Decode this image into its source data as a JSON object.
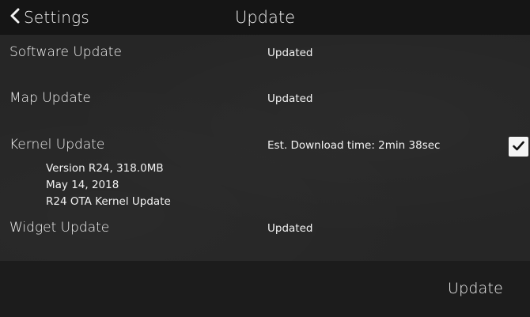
{
  "header": {
    "back_label": "Settings",
    "title": "Update"
  },
  "updates": [
    {
      "label": "Software Update",
      "status": "Updated"
    },
    {
      "label": "Map Update",
      "status": "Updated"
    },
    {
      "label": "Kernel Update",
      "status": "Est. Download time: 2min  38sec",
      "details": [
        "Version R24, 318.0MB",
        "May 14, 2018",
        "R24 OTA Kernel Update"
      ],
      "selected": true
    },
    {
      "label": "Widget Update",
      "status": "Updated"
    }
  ],
  "footer": {
    "update_label": "Update"
  },
  "icons": {
    "back": "chevron-left-icon",
    "check": "checkmark-icon"
  },
  "colors": {
    "header_bg": "#151515",
    "content_bg": "#262626",
    "footer_bg": "#1c1c1c",
    "text": "#f2f2f2",
    "checkbox_bg": "#f5f5f5"
  }
}
